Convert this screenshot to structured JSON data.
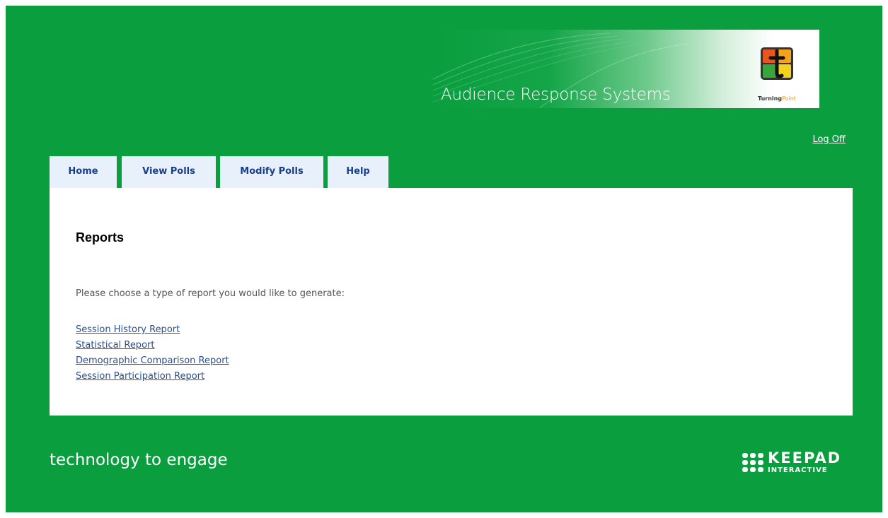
{
  "banner": {
    "title": "Audience Response Systems",
    "brand_part1": "Turning",
    "brand_part2": "Point",
    "logo_icon": "turningpoint-logo-icon"
  },
  "header": {
    "logoff_label": "Log Off"
  },
  "tabs": [
    {
      "label": "Home"
    },
    {
      "label": "View Polls"
    },
    {
      "label": "Modify Polls"
    },
    {
      "label": "Help"
    }
  ],
  "main": {
    "title": "Reports",
    "intro": "Please choose a type of report you would like to generate:",
    "reports": [
      {
        "label": "Session History Report"
      },
      {
        "label": "Statistical Report"
      },
      {
        "label": "Demographic Comparison Report"
      },
      {
        "label": "Session Participation Report"
      }
    ]
  },
  "footer": {
    "tagline": "technology to engage",
    "brand_word": "KEEPAD",
    "brand_sub": "INTERACTIVE",
    "brand_icon": "keepad-dots-icon"
  },
  "colors": {
    "background_green": "#0a9e3f",
    "tab_background": "#e8f0fb",
    "tab_text": "#1a3f8a",
    "link_text": "#2a4f8f"
  }
}
